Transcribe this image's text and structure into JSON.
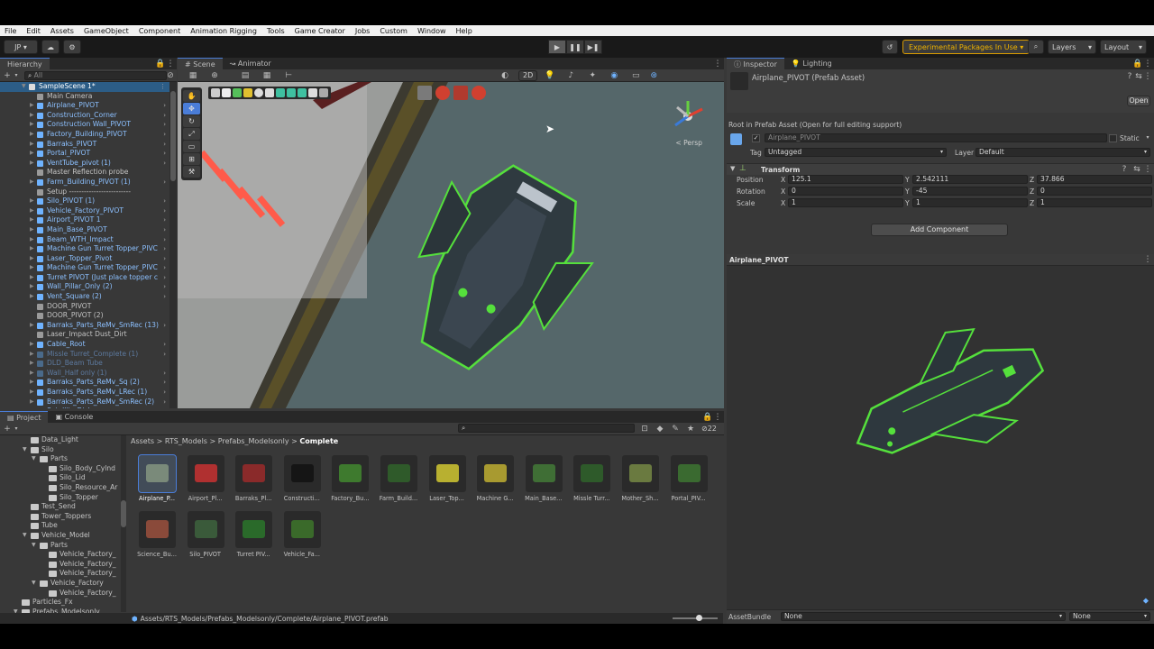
{
  "menu": [
    "File",
    "Edit",
    "Assets",
    "GameObject",
    "Component",
    "Animation Rigging",
    "Tools",
    "Game Creator",
    "Jobs",
    "Custom",
    "Window",
    "Help"
  ],
  "toolbar": {
    "account": "JP",
    "experimental": "Experimental Packages In Use",
    "layers": "Layers",
    "layout": "Layout"
  },
  "hierarchy": {
    "title": "Hierarchy",
    "search": "All",
    "scene": "SampleScene 1*",
    "items": [
      {
        "label": "Main Camera",
        "kind": "plain"
      },
      {
        "label": "Airplane_PIVOT",
        "kind": "prefab",
        "more": true
      },
      {
        "label": "Construction_Corner",
        "kind": "prefab",
        "more": true
      },
      {
        "label": "Construction Wall_PIVOT",
        "kind": "prefab",
        "more": true
      },
      {
        "label": "Factory_Building_PIVOT",
        "kind": "prefab",
        "more": true
      },
      {
        "label": "Barraks_PIVOT",
        "kind": "prefab",
        "more": true
      },
      {
        "label": "Portal_PIVOT",
        "kind": "prefab",
        "more": true
      },
      {
        "label": "VentTube_pivot (1)",
        "kind": "prefab",
        "more": true
      },
      {
        "label": "Master Reflection probe",
        "kind": "plain"
      },
      {
        "label": "Farm_Building_PIVOT (1)",
        "kind": "prefab",
        "more": true
      },
      {
        "label": "Setup -------------------------",
        "kind": "plain"
      },
      {
        "label": "Silo_PIVOT (1)",
        "kind": "prefab",
        "more": true
      },
      {
        "label": "Vehicle_Factory_PIVOT",
        "kind": "prefab",
        "more": true
      },
      {
        "label": "Airport_PIVOT 1",
        "kind": "prefab",
        "more": true
      },
      {
        "label": "Main_Base_PIVOT",
        "kind": "prefab",
        "more": true
      },
      {
        "label": "Beam_WTH_Impact",
        "kind": "prefab",
        "more": true
      },
      {
        "label": "Machine Gun Turret Topper_PIVC",
        "kind": "prefab",
        "more": true
      },
      {
        "label": "Laser_Topper_Pivot",
        "kind": "prefab",
        "more": true
      },
      {
        "label": "Machine Gun Turret Topper_PIVC",
        "kind": "prefab",
        "more": true
      },
      {
        "label": "Turret PIVOT (Just place topper c",
        "kind": "prefab",
        "more": true
      },
      {
        "label": "Wall_Pillar_Only (2)",
        "kind": "prefab",
        "more": true
      },
      {
        "label": "Vent_Square (2)",
        "kind": "prefab",
        "more": true
      },
      {
        "label": "DOOR_PIVOT",
        "kind": "plain"
      },
      {
        "label": "DOOR_PIVOT (2)",
        "kind": "plain"
      },
      {
        "label": "Barraks_Parts_ReMv_SmRec (13)",
        "kind": "prefab",
        "more": true
      },
      {
        "label": "Laser_Impact Dust_Dirt",
        "kind": "plain"
      },
      {
        "label": "Cable_Root",
        "kind": "prefab",
        "more": true
      },
      {
        "label": "Missle Turret_Complete (1)",
        "kind": "dim",
        "more": true
      },
      {
        "label": "DLD_Beam Tube",
        "kind": "dim",
        "more": false
      },
      {
        "label": "Wall_Half only (1)",
        "kind": "dim",
        "more": true
      },
      {
        "label": "Barraks_Parts_ReMv_Sq (2)",
        "kind": "prefab",
        "more": true
      },
      {
        "label": "Barraks_Parts_ReMv_LRec (1)",
        "kind": "prefab",
        "more": true
      },
      {
        "label": "Barraks_Parts_ReMv_SmRec (2)",
        "kind": "prefab",
        "more": true
      },
      {
        "label": "Satellite Dish",
        "kind": "prefab",
        "more": true
      }
    ]
  },
  "scene": {
    "tab_scene": "Scene",
    "tab_animator": "Animator",
    "btn_2d": "2D",
    "persp": "< Persp"
  },
  "project": {
    "tab_project": "Project",
    "tab_console": "Console",
    "count": "22",
    "breadcrumb": [
      "Assets",
      "RTS_Models",
      "Prefabs_Modelsonly",
      "Complete"
    ],
    "tree": [
      {
        "label": "Data_Light",
        "depth": 1
      },
      {
        "label": "Silo",
        "depth": 1,
        "open": true
      },
      {
        "label": "Parts",
        "depth": 2,
        "open": true
      },
      {
        "label": "Silo_Body_Cylnd",
        "depth": 3
      },
      {
        "label": "Silo_Lid",
        "depth": 3
      },
      {
        "label": "Silo_Resource_Ar",
        "depth": 3
      },
      {
        "label": "Silo_Topper",
        "depth": 3
      },
      {
        "label": "Test_Send",
        "depth": 1
      },
      {
        "label": "Tower_Toppers",
        "depth": 1
      },
      {
        "label": "Tube",
        "depth": 1
      },
      {
        "label": "Vehicle_Model",
        "depth": 1,
        "open": true
      },
      {
        "label": "Parts",
        "depth": 2,
        "open": true
      },
      {
        "label": "Vehicle_Factory_",
        "depth": 3
      },
      {
        "label": "Vehicle_Factory_",
        "depth": 3
      },
      {
        "label": "Vehicle_Factory_",
        "depth": 3
      },
      {
        "label": "Vehicle_Factory",
        "depth": 2,
        "open": true
      },
      {
        "label": "Vehicle_Factory_",
        "depth": 3
      },
      {
        "label": "Particles_Fx",
        "depth": 0
      },
      {
        "label": "Prefabs_Modelsonly",
        "depth": 0,
        "open": true
      },
      {
        "label": "Complete",
        "depth": 1,
        "sel": true
      }
    ],
    "assets": [
      {
        "label": "Airplane_P...",
        "color": "#7a8a7a",
        "sel": true
      },
      {
        "label": "Airport_Pl...",
        "color": "#b03030"
      },
      {
        "label": "Barraks_Pl...",
        "color": "#8a2a2a"
      },
      {
        "label": "Constructi...",
        "color": "#151515"
      },
      {
        "label": "Factory_Bu...",
        "color": "#3e7a2e"
      },
      {
        "label": "Farm_Build...",
        "color": "#2f5a2a"
      },
      {
        "label": "Laser_Top...",
        "color": "#b8b030"
      },
      {
        "label": "Machine G...",
        "color": "#a89a30"
      },
      {
        "label": "Main_Base...",
        "color": "#3f6e35"
      },
      {
        "label": "Missle Turr...",
        "color": "#2e5a2a"
      },
      {
        "label": "Mother_Sh...",
        "color": "#6a7a40"
      },
      {
        "label": "Portal_PIV...",
        "color": "#3a6a30"
      },
      {
        "label": "Science_Bu...",
        "color": "#8a4a3a"
      },
      {
        "label": "Silo_PIVOT",
        "color": "#3a5a3a"
      },
      {
        "label": "Turret PIV...",
        "color": "#2a6a2a"
      },
      {
        "label": "Vehicle_Fa...",
        "color": "#3a6a2a"
      }
    ],
    "path": "Assets/RTS_Models/Prefabs_Modelsonly/Complete/Airplane_PIVOT.prefab"
  },
  "inspector": {
    "tab_inspector": "Inspector",
    "tab_lighting": "Lighting",
    "asset_title": "Airplane_PIVOT (Prefab Asset)",
    "open_btn": "Open",
    "root_note": "Root in Prefab Asset (Open for full editing support)",
    "name": "Airplane_PIVOT",
    "static": "Static",
    "tag_label": "Tag",
    "tag": "Untagged",
    "layer_label": "Layer",
    "layer": "Default",
    "transform": "Transform",
    "position": {
      "label": "Position",
      "x": "125.1",
      "y": "2.542111",
      "z": "37.866"
    },
    "rotation": {
      "label": "Rotation",
      "x": "0",
      "y": "-45",
      "z": "0"
    },
    "scale": {
      "label": "Scale",
      "x": "1",
      "y": "1",
      "z": "1"
    },
    "add_component": "Add Component",
    "preview_title": "Airplane_PIVOT",
    "assetbundle_label": "AssetBundle",
    "assetbundle": "None",
    "variant": "None"
  }
}
